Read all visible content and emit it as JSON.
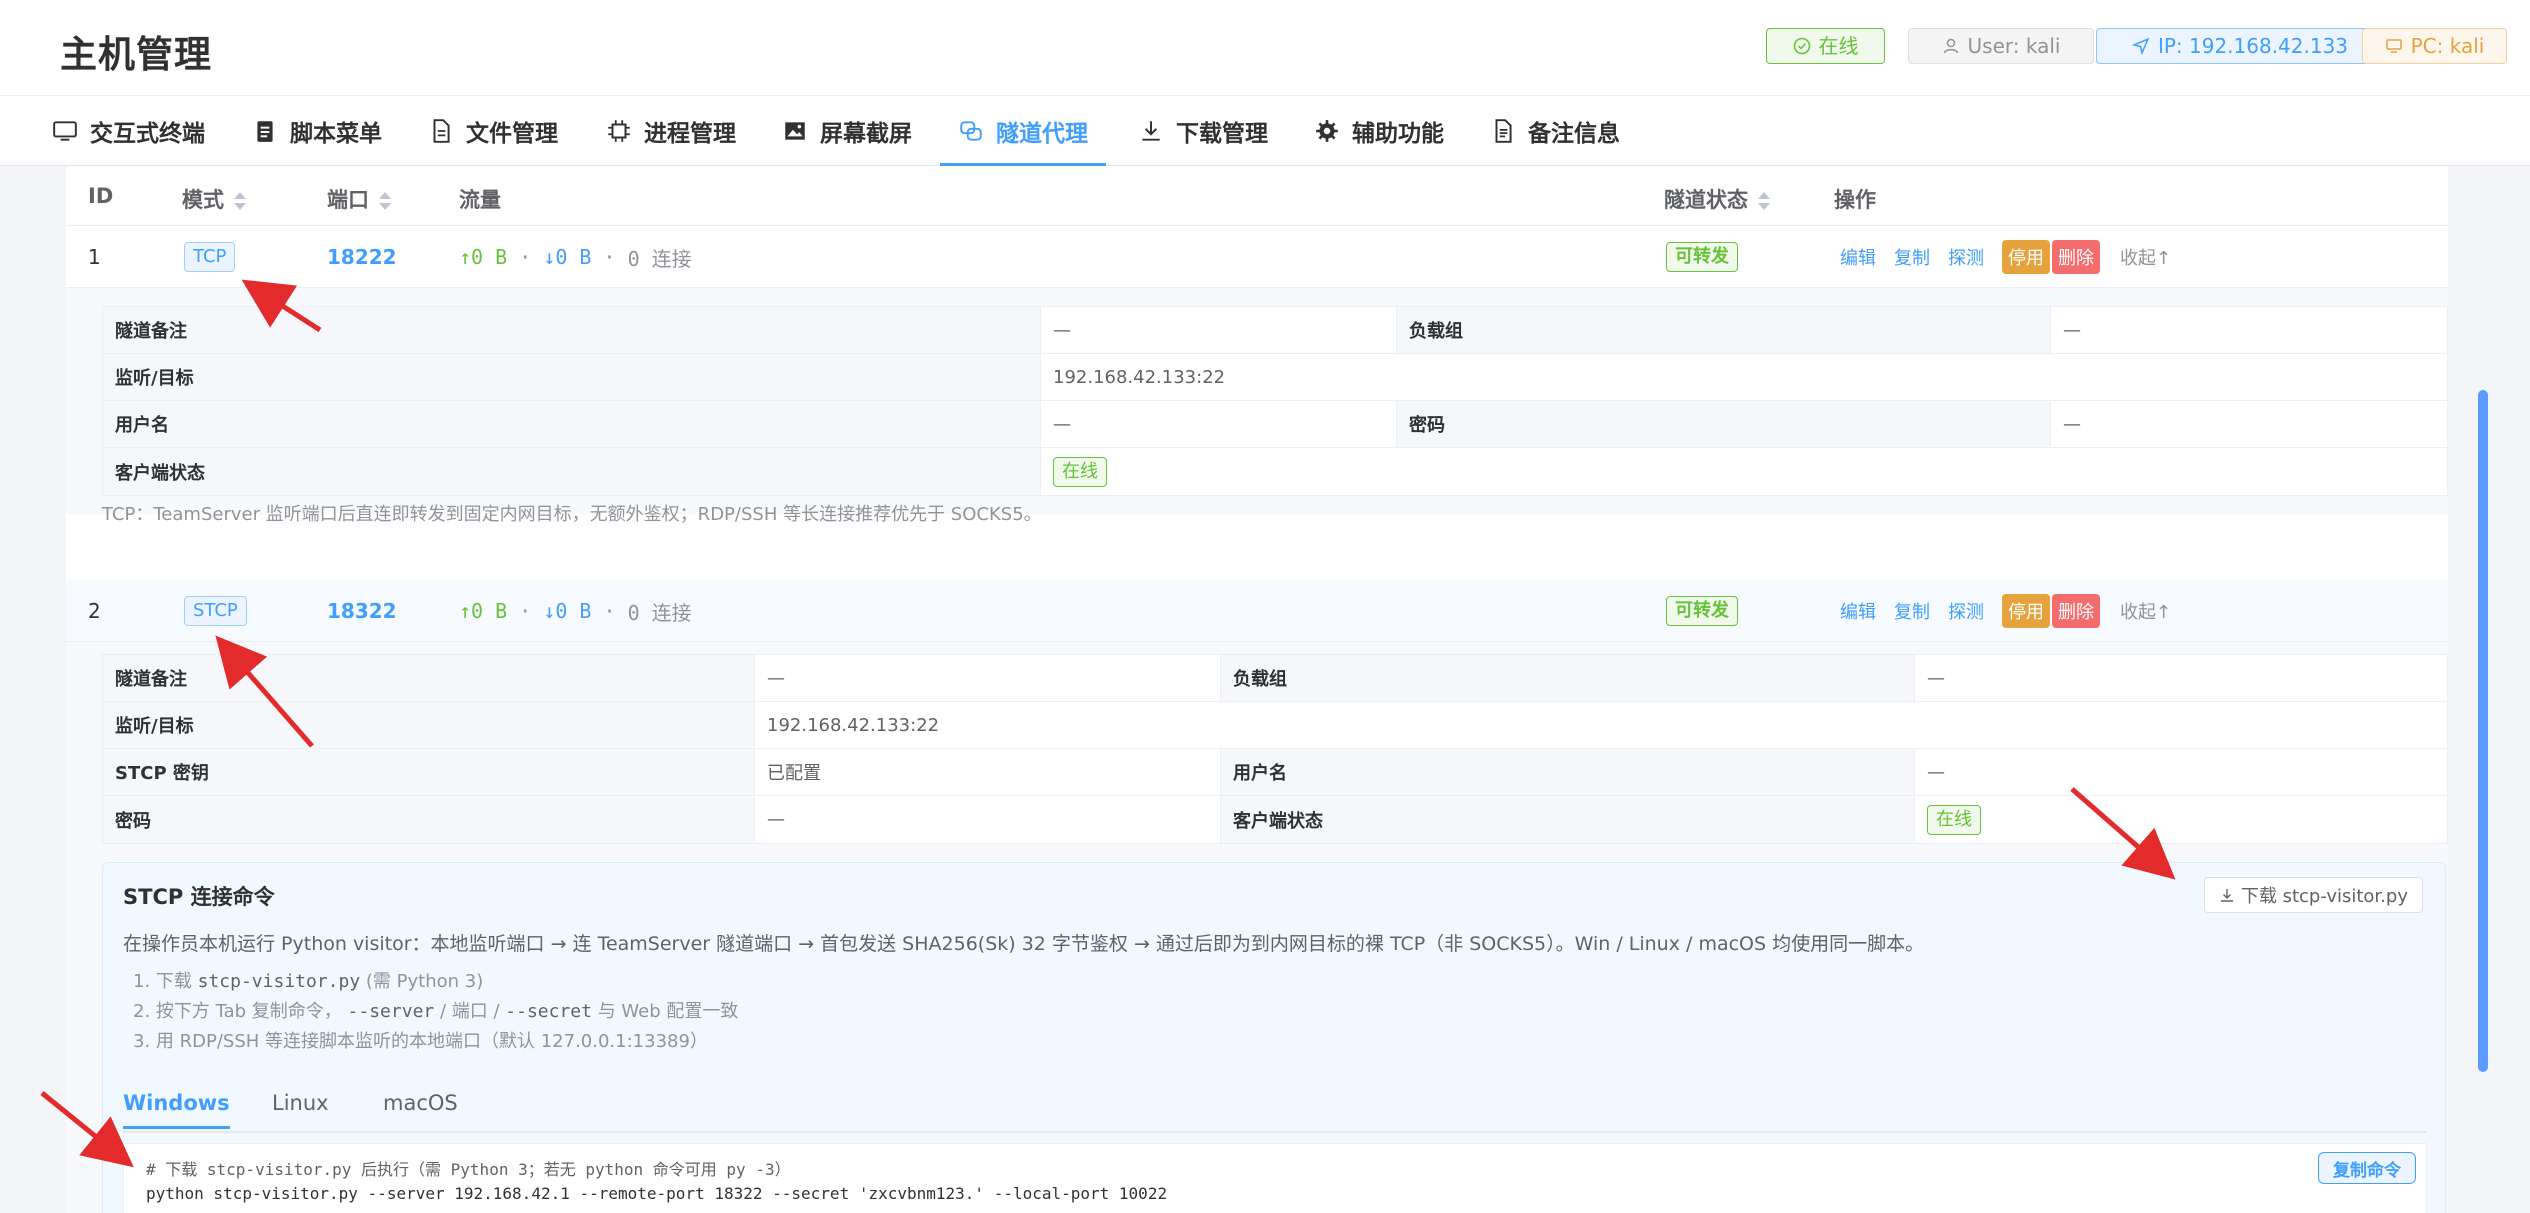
{
  "app": {
    "title": "主机管理"
  },
  "status": {
    "online": "在线",
    "user": "User: kali",
    "ip": "IP: 192.168.42.133",
    "pc": "PC: kali"
  },
  "tabs": [
    {
      "label": "交互式终端",
      "icon": "monitor-icon"
    },
    {
      "label": "脚本菜单",
      "icon": "clipboard-icon"
    },
    {
      "label": "文件管理",
      "icon": "file-icon"
    },
    {
      "label": "进程管理",
      "icon": "cpu-icon"
    },
    {
      "label": "屏幕截屏",
      "icon": "image-icon"
    },
    {
      "label": "隧道代理",
      "icon": "link-icon",
      "active": true
    },
    {
      "label": "下载管理",
      "icon": "download-icon"
    },
    {
      "label": "辅助功能",
      "icon": "gear-icon"
    },
    {
      "label": "备注信息",
      "icon": "document-icon"
    }
  ],
  "table": {
    "headers": {
      "id": "ID",
      "mode": "模式",
      "port": "端口",
      "traffic": "流量",
      "state": "隧道状态",
      "ops": "操作"
    },
    "ops": {
      "edit": "编辑",
      "copy": "复制",
      "probe": "探测",
      "disable": "停用",
      "delete": "删除",
      "collapse": "收起↑"
    },
    "rows": [
      {
        "id": "1",
        "mode": "TCP",
        "port": "18222",
        "up": "↑0 B",
        "down": "↓0 B",
        "conns": "0 连接",
        "state": "可转发",
        "detail": {
          "remark_label": "隧道备注",
          "remark": "—",
          "lb_label": "负载组",
          "lb": "—",
          "target_label": "监听/目标",
          "target": "192.168.42.133:22",
          "user_label": "用户名",
          "user": "—",
          "pwd_label": "密码",
          "pwd": "—",
          "client_label": "客户端状态",
          "client": "在线"
        },
        "note": "TCP：TeamServer 监听端口后直连即转发到固定内网目标，无额外鉴权；RDP/SSH 等长连接推荐优先于 SOCKS5。"
      },
      {
        "id": "2",
        "mode": "STCP",
        "port": "18322",
        "up": "↑0 B",
        "down": "↓0 B",
        "conns": "0 连接",
        "state": "可转发",
        "detail": {
          "remark_label": "隧道备注",
          "remark": "—",
          "lb_label": "负载组",
          "lb": "—",
          "target_label": "监听/目标",
          "target": "192.168.42.133:22",
          "secret_label": "STCP 密钥",
          "secret": "已配置",
          "user_label": "用户名",
          "user": "—",
          "pwd_label": "密码",
          "pwd": "—",
          "client_label": "客户端状态",
          "client": "在线"
        }
      }
    ]
  },
  "stcp": {
    "title": "STCP 连接命令",
    "download_btn": "下载 stcp-visitor.py",
    "desc": "在操作员本机运行 Python visitor：本地监听端口 → 连 TeamServer 隧道端口 → 首包发送 SHA256(Sk) 32 字节鉴权 → 通过后即为到内网目标的裸 TCP（非 SOCKS5）。Win / Linux / macOS 均使用同一脚本。",
    "step1_a": "1. 下载 ",
    "step1_code": "stcp-visitor.py",
    "step1_b": " (需 Python 3)",
    "step2_a": "2. 按下方 Tab 复制命令， ",
    "step2_code1": "--server",
    "step2_b": " / 端口 / ",
    "step2_code2": "--secret",
    "step2_c": " 与 Web 配置一致",
    "step3": "3. 用 RDP/SSH 等连接脚本监听的本地端口（默认 127.0.0.1:13389）",
    "os_tabs": [
      "Windows",
      "Linux",
      "macOS"
    ],
    "code_line1": "# 下载 stcp-visitor.py 后执行（需 Python 3；若无 python 命令可用 py -3）",
    "code_line2": "python stcp-visitor.py --server 192.168.42.1 --remote-port 18322 --secret 'zxcvbnm123.' --local-port 10022",
    "copy_btn": "复制命令"
  }
}
